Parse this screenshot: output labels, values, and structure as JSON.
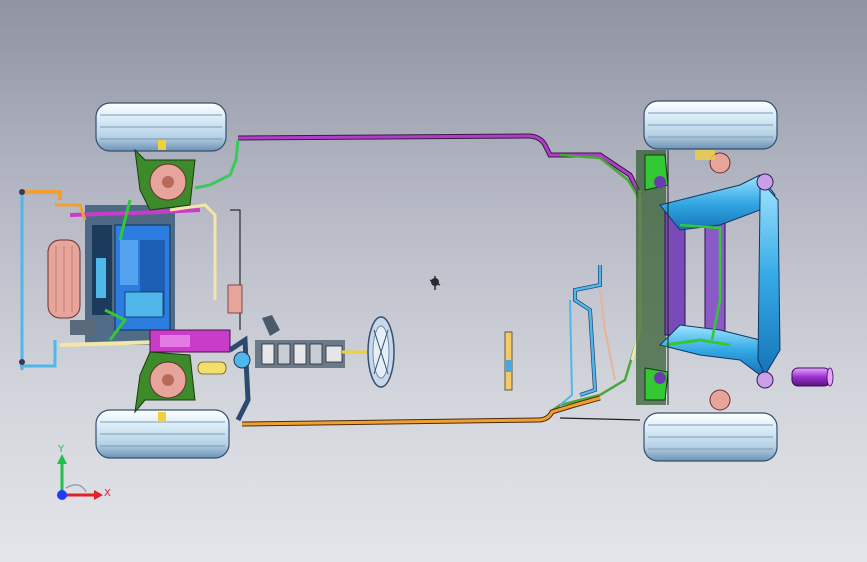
{
  "viewport": {
    "name": "CAD 3D viewport",
    "background_top": "#8f93a2",
    "background_bottom": "#e4e5ea"
  },
  "triad": {
    "x_label": "X",
    "y_label": "Y",
    "x_color": "#e0202a",
    "y_color": "#22c04a",
    "origin_color": "#1e3cff"
  },
  "colors": {
    "tire": "#d9ebf5",
    "tire_shade": "#7fa6c7",
    "fuel_line_purple": "#b03cc8",
    "fuel_line_orange": "#f0a030",
    "rear_axle_blue": "#2aa7e6",
    "suspension_green": "#34c834",
    "frame_magenta": "#c83cc8",
    "engine_blue": "#2c7de0",
    "exhaust_purple": "#9b30d0"
  },
  "components": [
    "front-left-wheel",
    "front-right-wheel",
    "rear-left-wheel",
    "rear-right-wheel",
    "engine-assembly",
    "fuel-tank",
    "steering-column",
    "steering-wheel",
    "brake-line-top",
    "brake-line-bottom",
    "rear-axle",
    "muffler"
  ]
}
